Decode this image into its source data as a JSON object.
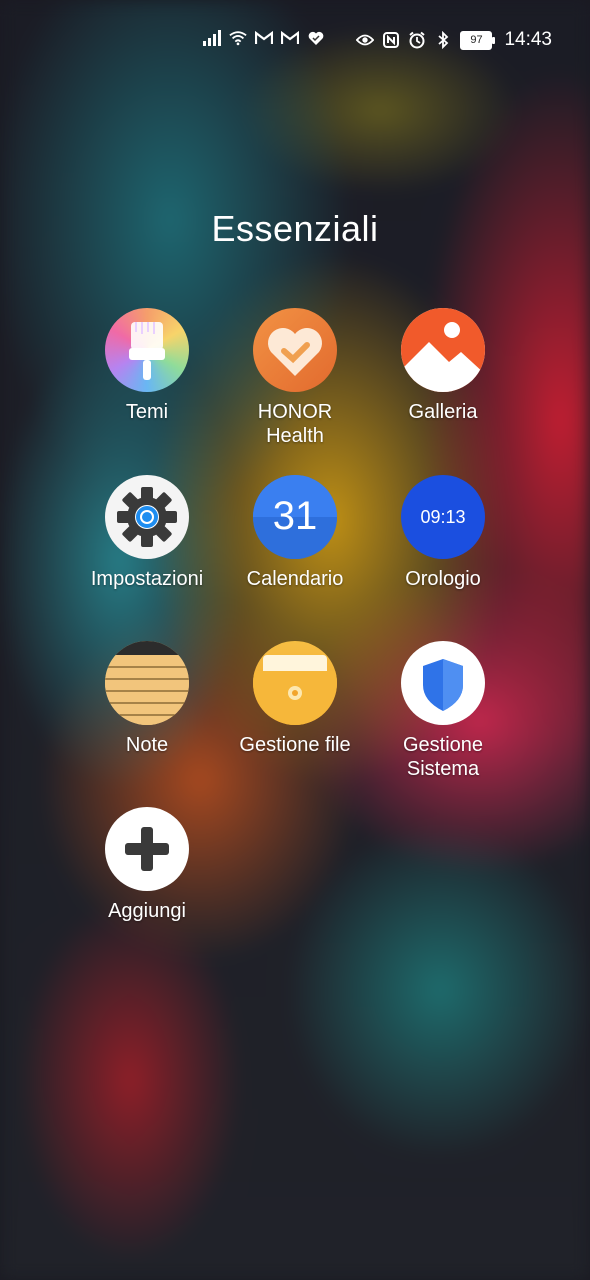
{
  "status_bar": {
    "time": "14:43",
    "battery": "97",
    "left_icons": [
      "signal-icon",
      "wifi-icon",
      "gmail-icon",
      "gmail-icon",
      "heart-icon"
    ],
    "right_icons": [
      "eye-icon",
      "nfc-icon",
      "alarm-icon",
      "bluetooth-icon"
    ]
  },
  "folder": {
    "title": "Essenziali",
    "apps": [
      {
        "label": "Temi",
        "icon": "themes-brush-icon"
      },
      {
        "label": "HONOR Health",
        "icon": "honor-health-icon"
      },
      {
        "label": "Galleria",
        "icon": "gallery-icon"
      },
      {
        "label": "Impostazioni",
        "icon": "settings-gear-icon"
      },
      {
        "label": "Calendario",
        "icon": "calendar-icon",
        "day": "31"
      },
      {
        "label": "Orologio",
        "icon": "clock-icon",
        "time": "09:13"
      },
      {
        "label": "Note",
        "icon": "notes-icon"
      },
      {
        "label": "Gestione file",
        "icon": "file-manager-icon"
      },
      {
        "label": "Gestione Sistema",
        "icon": "system-manager-shield-icon"
      },
      {
        "label": "Aggiungi",
        "icon": "add-plus-icon"
      }
    ]
  }
}
